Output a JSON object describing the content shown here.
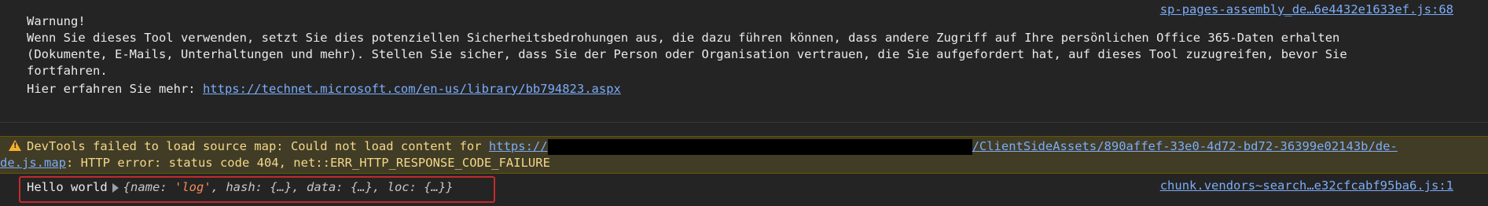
{
  "info_message": {
    "source_link": "sp-pages-assembly_de…6e4432e1633ef.js:68",
    "lines": [
      "Warnung!",
      "Wenn Sie dieses Tool verwenden, setzt Sie dies potenziellen Sicherheitsbedrohungen aus, die dazu führen können, dass andere Zugriff auf Ihre persönlichen Office 365-Daten erhalten",
      "(Dokumente, E-Mails, Unterhaltungen und mehr). Stellen Sie sicher, dass Sie der Person oder Organisation vertrauen, die Sie aufgefordert hat, auf dieses Tool zuzugreifen, bevor Sie",
      "fortfahren."
    ],
    "learn_more_label": "Hier erfahren Sie mehr: ",
    "learn_more_url": "https://technet.microsoft.com/en-us/library/bb794823.aspx"
  },
  "warning_message": {
    "icon": "warning-triangle-icon",
    "prefix": "DevTools failed to load source map: Could not load content for ",
    "url_start": "https://",
    "url_end": "/ClientSideAssets/890affef-33e0-4d72-bd72-36399e02143b/de-",
    "url_cont": "de.js.map",
    "suffix": ": HTTP error: status code 404, net::ERR_HTTP_RESPONSE_CODE_FAILURE"
  },
  "log_message": {
    "text": "Hello world",
    "object_open": "{",
    "name_key": "name: ",
    "name_value": "'log'",
    "rest": ", hash: {…}, data: {…}, loc: {…}}",
    "source_link": "chunk.vendors~search…e32cfcabf95ba6.js:1"
  },
  "colors": {
    "background": "#242424",
    "link": "#7cacf8",
    "warning_bg": "#413c26",
    "warning_text": "#f3d889",
    "highlight_border": "#c42b2b"
  }
}
